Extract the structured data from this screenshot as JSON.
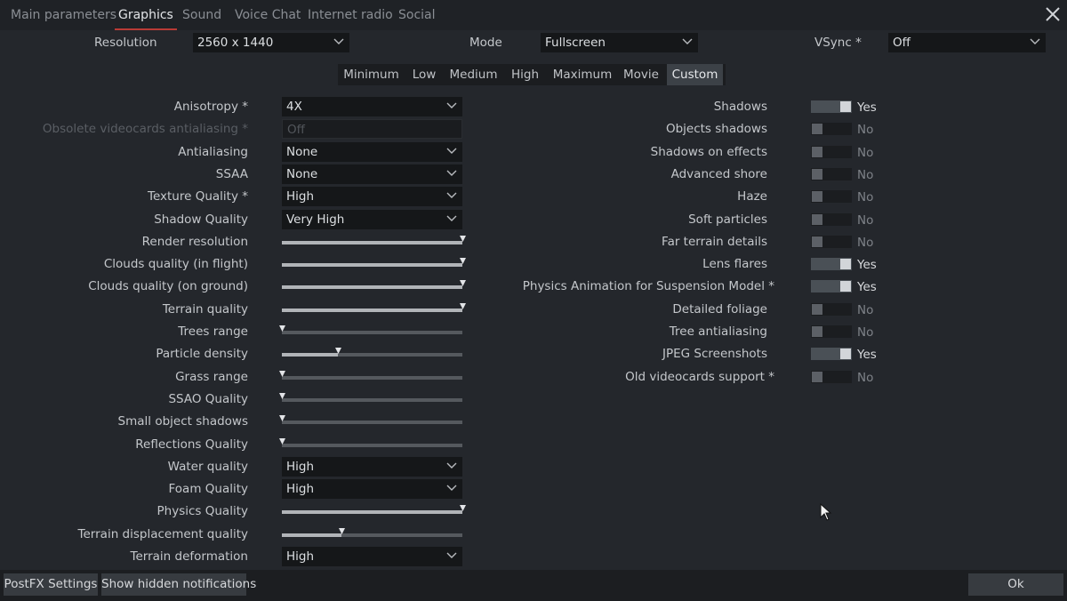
{
  "tabs": [
    "Main parameters",
    "Graphics",
    "Sound",
    "Voice Chat",
    "Internet radio",
    "Social"
  ],
  "active_tab": "Graphics",
  "top_settings": {
    "resolution": {
      "label": "Resolution",
      "value": "2560 x 1440"
    },
    "mode": {
      "label": "Mode",
      "value": "Fullscreen"
    },
    "vsync": {
      "label": "VSync *",
      "value": "Off"
    }
  },
  "presets": [
    "Minimum",
    "Low",
    "Medium",
    "High",
    "Maximum",
    "Movie",
    "Custom"
  ],
  "active_preset": "Custom",
  "left_settings": [
    {
      "label": "Anisotropy *",
      "type": "dropdown",
      "value": "4X"
    },
    {
      "label": "Obsolete videocards antialiasing *",
      "type": "disabled",
      "value": "Off"
    },
    {
      "label": "Antialiasing",
      "type": "dropdown",
      "value": "None"
    },
    {
      "label": "SSAA",
      "type": "dropdown",
      "value": "None"
    },
    {
      "label": "Texture Quality *",
      "type": "dropdown",
      "value": "High"
    },
    {
      "label": "Shadow Quality",
      "type": "dropdown",
      "value": "Very High"
    },
    {
      "label": "Render resolution",
      "type": "slider",
      "level": 1.0
    },
    {
      "label": "Clouds quality (in flight)",
      "type": "slider",
      "level": 1.0
    },
    {
      "label": "Clouds quality (on ground)",
      "type": "slider",
      "level": 1.0
    },
    {
      "label": "Terrain quality",
      "type": "slider",
      "level": 1.0
    },
    {
      "label": "Trees range",
      "type": "slider",
      "level": 0.0
    },
    {
      "label": "Particle density",
      "type": "slider",
      "level": 0.31
    },
    {
      "label": "Grass range",
      "type": "slider",
      "level": 0.0
    },
    {
      "label": "SSAO Quality",
      "type": "slider",
      "level": 0.0
    },
    {
      "label": "Small object shadows",
      "type": "slider",
      "level": 0.0
    },
    {
      "label": "Reflections Quality",
      "type": "slider",
      "level": 0.0
    },
    {
      "label": "Water quality",
      "type": "dropdown",
      "value": "High"
    },
    {
      "label": "Foam Quality",
      "type": "dropdown",
      "value": "High"
    },
    {
      "label": "Physics Quality",
      "type": "slider",
      "level": 1.0
    },
    {
      "label": "Terrain displacement quality",
      "type": "slider",
      "level": 0.33
    },
    {
      "label": "Terrain deformation",
      "type": "dropdown",
      "value": "High"
    }
  ],
  "right_settings": [
    {
      "label": "Shadows",
      "on": true,
      "value": "Yes"
    },
    {
      "label": "Objects shadows",
      "on": false,
      "value": "No"
    },
    {
      "label": "Shadows on effects",
      "on": false,
      "value": "No"
    },
    {
      "label": "Advanced shore",
      "on": false,
      "value": "No"
    },
    {
      "label": "Haze",
      "on": false,
      "value": "No"
    },
    {
      "label": "Soft particles",
      "on": false,
      "value": "No"
    },
    {
      "label": "Far terrain details",
      "on": false,
      "value": "No"
    },
    {
      "label": "Lens flares",
      "on": true,
      "value": "Yes"
    },
    {
      "label": "Physics Animation for Suspension Model *",
      "on": true,
      "value": "Yes"
    },
    {
      "label": "Detailed foliage",
      "on": false,
      "value": "No"
    },
    {
      "label": "Tree antialiasing",
      "on": false,
      "value": "No"
    },
    {
      "label": "JPEG Screenshots",
      "on": true,
      "value": "Yes"
    },
    {
      "label": "Old videocards support *",
      "on": false,
      "value": "No"
    }
  ],
  "bottom_buttons": {
    "postfx": "PostFX Settings",
    "notifications": "Show hidden notifications",
    "ok": "Ok"
  },
  "icons": {
    "close": "close-icon",
    "dropdown": "chevron-down-icon",
    "slider_thumb": "slider-thumb-icon",
    "cursor": "mouse-cursor-icon"
  },
  "colors": {
    "active_tab_underline": "#b93b36",
    "background": "#24272c",
    "field": "#151719"
  }
}
